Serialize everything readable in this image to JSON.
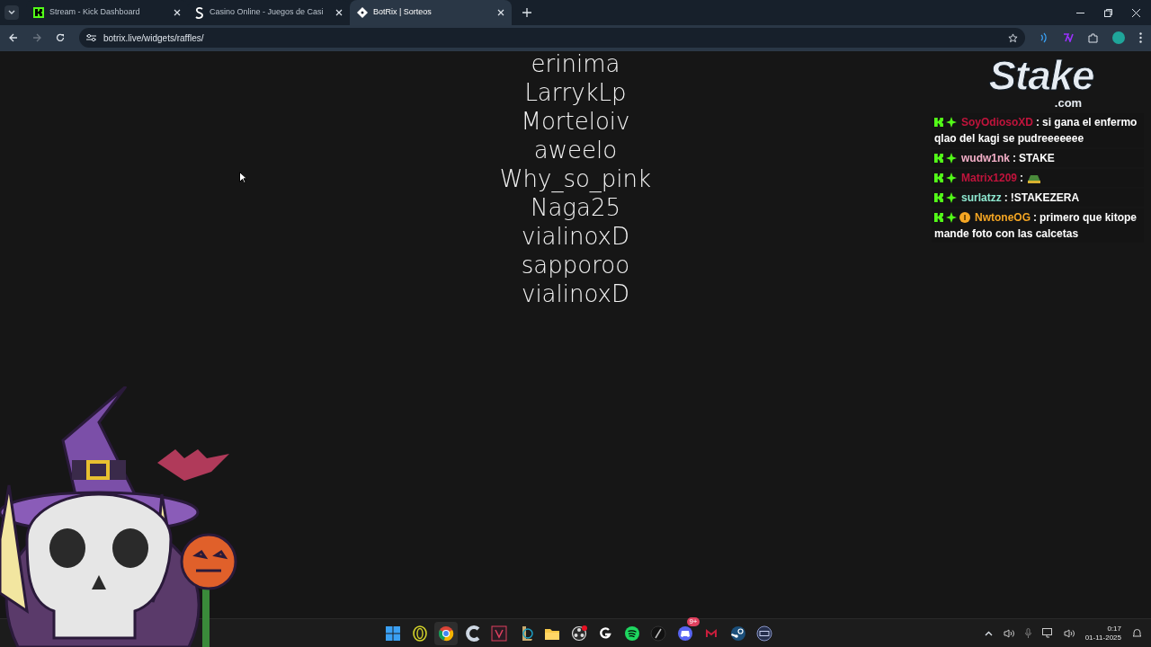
{
  "tabs": [
    {
      "title": "Stream - Kick Dashboard",
      "kind": "kick",
      "selected": false
    },
    {
      "title": "Casino Online - Juegos de Casi",
      "kind": "stake",
      "selected": false
    },
    {
      "title": "BotRix | Sorteos",
      "kind": "botrix",
      "selected": true
    }
  ],
  "address": "botrix.live/widgets/raffles/",
  "raffle_names": [
    "erinima",
    "LarrykLp",
    "Morteloiv",
    "aweelo",
    "Why_so_pink",
    "Naga25",
    "vialinoxD",
    "sapporoo",
    "vialinoxD"
  ],
  "logo": {
    "text": "Stake",
    "suffix": ".com"
  },
  "chat": [
    {
      "user": "SoyOdiosoXD",
      "color": "#c0143c",
      "coin_badge": false,
      "separator": ":",
      "kind": "text",
      "lines": [
        "si gana el enfermo",
        "qlao del kagi se pudreeeeeee"
      ]
    },
    {
      "user": "wudw1nk",
      "color": "#f4b0c8",
      "coin_badge": false,
      "separator": ":",
      "kind": "text",
      "lines": [
        "STAKE"
      ]
    },
    {
      "user": "Matrix1209",
      "color": "#c0143c",
      "coin_badge": false,
      "separator": ":",
      "kind": "emote"
    },
    {
      "user": "surlatzz",
      "color": "#8ee8d0",
      "coin_badge": false,
      "separator": ":",
      "kind": "text",
      "lines": [
        "!STAKEZERA"
      ]
    },
    {
      "user": "NwtoneOG",
      "color": "#f5a623",
      "coin_badge": true,
      "separator": ":",
      "kind": "text",
      "lines": [
        "primero que kitope",
        "mande foto con las calcetas"
      ]
    }
  ],
  "taskbar": [
    {
      "kind": "start",
      "selected": false
    },
    {
      "kind": "opera",
      "selected": false
    },
    {
      "kind": "chrome",
      "selected": true
    },
    {
      "kind": "ccleaner",
      "selected": false
    },
    {
      "kind": "valorant",
      "selected": false
    },
    {
      "kind": "league",
      "selected": false
    },
    {
      "kind": "folder",
      "selected": false
    },
    {
      "kind": "obs",
      "selected": false
    },
    {
      "kind": "logitech",
      "selected": false
    },
    {
      "kind": "spotify",
      "selected": false
    },
    {
      "kind": "epic",
      "selected": false
    },
    {
      "kind": "discord",
      "selected": false,
      "badge": "9+"
    },
    {
      "kind": "mega",
      "selected": false
    },
    {
      "kind": "steam",
      "selected": false
    },
    {
      "kind": "keyboard",
      "selected": false
    }
  ],
  "clock": {
    "time": "0:17",
    "date": "01-11-2025"
  }
}
